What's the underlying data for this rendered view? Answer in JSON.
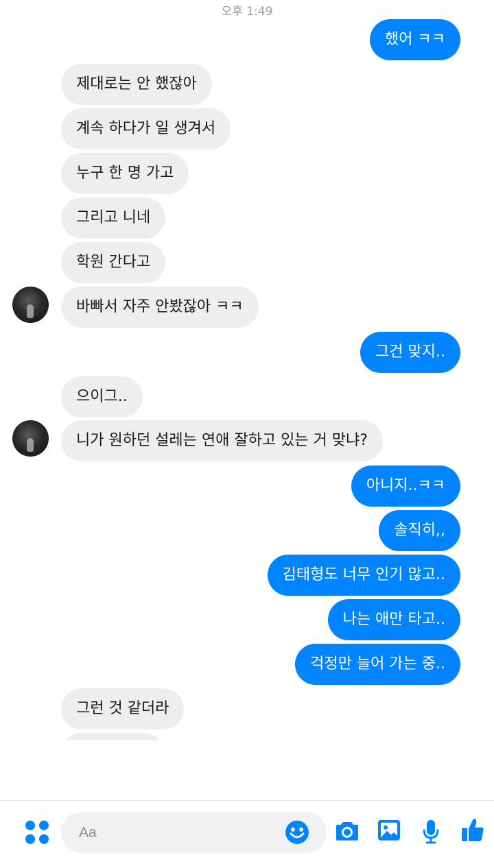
{
  "header": {
    "timestamp": "오후 1:49"
  },
  "messages": [
    {
      "side": "out",
      "text": "했어 ㅋㅋ"
    },
    {
      "side": "in",
      "text": "제대로는 안 했잖아"
    },
    {
      "side": "in",
      "text": "계속 하다가 일 생겨서"
    },
    {
      "side": "in",
      "text": "누구 한 명 가고"
    },
    {
      "side": "in",
      "text": "그리고 니네"
    },
    {
      "side": "in",
      "text": "학원 간다고"
    },
    {
      "side": "in",
      "text": "바빠서 자주 안봤잖아 ㅋㅋ"
    },
    {
      "side": "out",
      "text": "그건 맞지.."
    },
    {
      "side": "in",
      "text": "으이그.."
    },
    {
      "side": "in",
      "text": "니가 원하던 설레는 연애 잘하고 있는 거 맞냐?"
    },
    {
      "side": "out",
      "text": "아니지..ㅋㅋ"
    },
    {
      "side": "out",
      "text": "솔직히,,"
    },
    {
      "side": "out",
      "text": "김태형도 너무 인기 많고.."
    },
    {
      "side": "out",
      "text": "나는 애만 타고.."
    },
    {
      "side": "out",
      "text": "걱정만 늘어 가는 중.."
    },
    {
      "side": "in",
      "text": "그런 것 같더라"
    }
  ],
  "composer": {
    "placeholder": "Aa",
    "icons": [
      "apps-icon",
      "emoji-icon",
      "camera-icon",
      "image-icon",
      "microphone-icon",
      "thumbs-up-icon"
    ]
  },
  "colors": {
    "accent": "#0084ff",
    "incoming_bubble": "#eeeeee",
    "timestamp_text": "#9a9a9a"
  }
}
